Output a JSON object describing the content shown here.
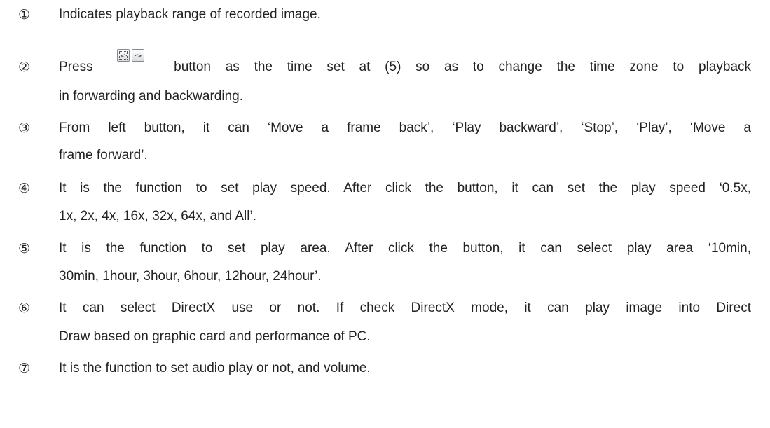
{
  "items": [
    {
      "marker": "①",
      "lines": [
        "Indicates playback range of recorded image."
      ]
    },
    {
      "marker": "②",
      "line1_before": "Press",
      "line1_after": "button as the time set at (5) so as to change the time zone to playback",
      "line2": "in forwarding and backwarding.",
      "buttons": [
        {
          "icon": "backward-arrow-icon"
        },
        {
          "icon": "forward-arrow-icon"
        }
      ]
    },
    {
      "marker": "③",
      "lines": [
        "From left button, it can ‘Move a frame back’, ‘Play backward’, ‘Stop’, ‘Play’, ‘Move a",
        "frame forward’."
      ]
    },
    {
      "marker": "④",
      "lines": [
        "It is the function to set play speed. After click the button, it can set the play speed ‘0.5x,",
        "1x, 2x, 4x, 16x, 32x, 64x, and All’."
      ]
    },
    {
      "marker": "⑤",
      "lines": [
        "It is the function to set play area. After click the button, it can select play area ‘10min,",
        "30min, 1hour, 3hour, 6hour, 12hour, 24hour’."
      ]
    },
    {
      "marker": "⑥",
      "lines": [
        "It can select DirectX use or not. If check DirectX mode, it can play image into Direct",
        "Draw based on graphic card and performance of PC."
      ]
    },
    {
      "marker": "⑦",
      "lines": [
        "It is the function to set audio play or not, and volume."
      ]
    }
  ]
}
